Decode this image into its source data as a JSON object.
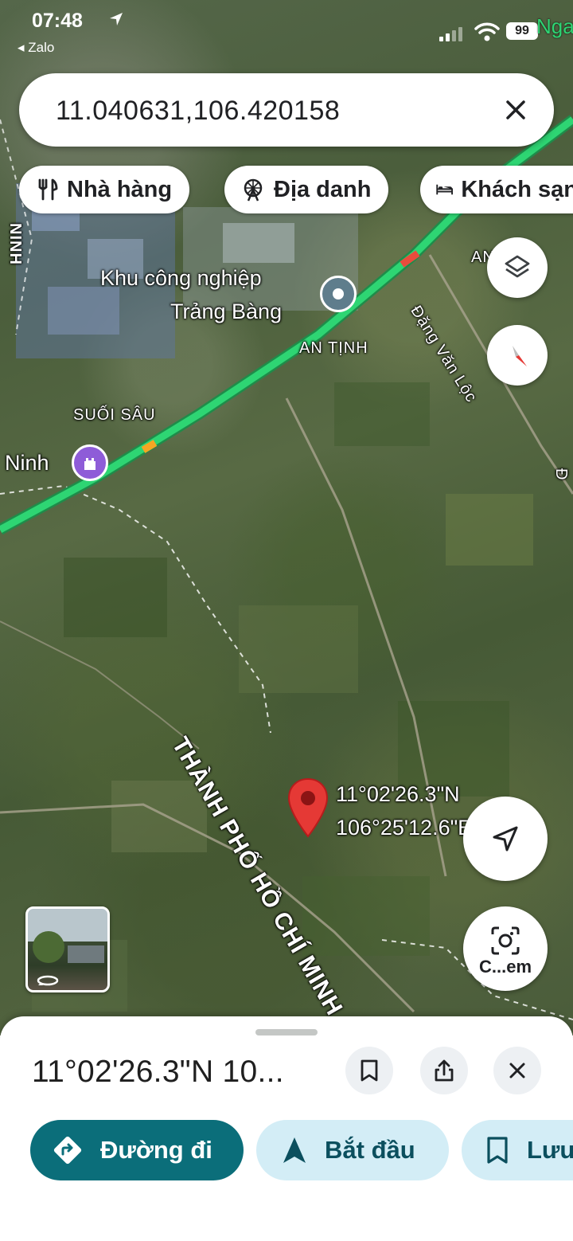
{
  "status_bar": {
    "time": "07:48",
    "back_app": "◂ Zalo",
    "battery": "99",
    "corner_text": "Nga"
  },
  "search": {
    "query": "11.040631,106.420158"
  },
  "chips": [
    {
      "label": "Nhà hàng",
      "icon": "fork-knife-icon"
    },
    {
      "label": "Địa danh",
      "icon": "ferris-wheel-icon"
    },
    {
      "label": "Khách sạn",
      "icon": "bed-icon"
    }
  ],
  "map": {
    "labels": {
      "industrial_zone_line1": "Khu công nghiệp",
      "industrial_zone_line2": "Trảng Bàng",
      "an_tinh": "AN TỊNH",
      "suoi_sau": "SUỐI SÂU",
      "ninh": "Ninh",
      "road_dang_van": "Đặng Văn Lộc",
      "city": "THÀNH PHỐ HỒ CHÍ MINH",
      "left_road": "NINH",
      "right_partial": "AN TỊNH",
      "right_edge": "Đ"
    },
    "pin": {
      "lat": "11°02'26.3\"N",
      "lng": "106°25'12.6\"E"
    }
  },
  "fabs": {
    "layers": "layers-icon",
    "compass": "compass-icon",
    "my_location": "navigation-arrow-icon",
    "camera_label": "C...em"
  },
  "sheet": {
    "title": "11°02'26.3\"N 10...",
    "actions": [
      {
        "label": "Đường đi",
        "style": "primary"
      },
      {
        "label": "Bắt đầu",
        "style": "secondary"
      },
      {
        "label": "Lưu",
        "style": "secondary"
      }
    ]
  },
  "colors": {
    "primary": "#0b6e7a",
    "secondary_bg": "#d3edf6",
    "highway": "#2ed573",
    "pin": "#e53935"
  }
}
